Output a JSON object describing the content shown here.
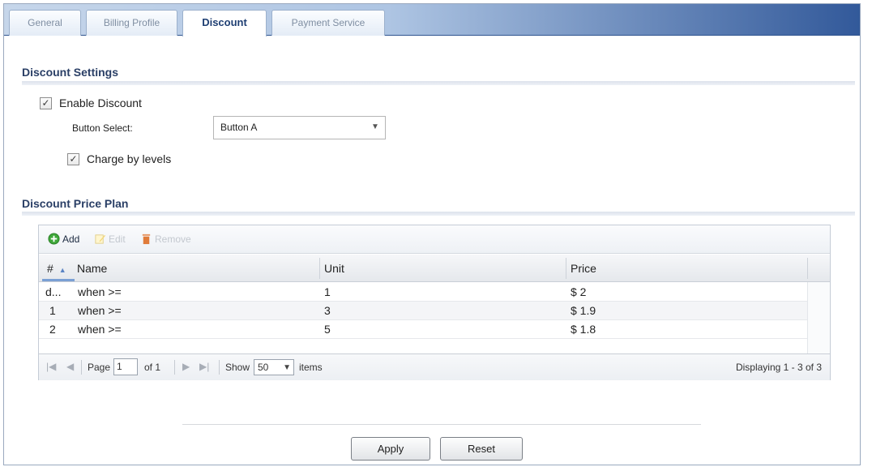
{
  "tabs": [
    {
      "label": "General",
      "active": false
    },
    {
      "label": "Billing Profile",
      "active": false
    },
    {
      "label": "Discount",
      "active": true
    },
    {
      "label": "Payment Service",
      "active": false
    }
  ],
  "discount_settings": {
    "title": "Discount Settings",
    "enable_discount": {
      "label": "Enable Discount",
      "checked": true
    },
    "button_select": {
      "label": "Button Select:",
      "value": "Button A"
    },
    "charge_by_levels": {
      "label": "Charge by levels",
      "checked": true
    }
  },
  "price_plan": {
    "title": "Discount Price Plan",
    "toolbar": {
      "add": "Add",
      "edit": "Edit",
      "remove": "Remove"
    },
    "columns": [
      "#",
      "Name",
      "Unit",
      "Price"
    ],
    "rows": [
      {
        "num": "d...",
        "name": "when >=",
        "unit": "1",
        "price": "$ 2"
      },
      {
        "num": "1",
        "name": "when >=",
        "unit": "3",
        "price": "$ 1.9"
      },
      {
        "num": "2",
        "name": "when >=",
        "unit": "5",
        "price": "$ 1.8"
      }
    ],
    "pager": {
      "page_label": "Page",
      "page_value": "1",
      "of_label": "of 1",
      "show_label": "Show",
      "show_value": "50",
      "items_label": "items",
      "displaying": "Displaying 1 - 3 of 3"
    }
  },
  "buttons": {
    "apply": "Apply",
    "reset": "Reset"
  },
  "colors": {
    "tab_active_text": "#1f3f73",
    "header_gradient_end": "#32599a",
    "add_icon": "#3fa83a",
    "remove_icon": "#e07b3a"
  }
}
